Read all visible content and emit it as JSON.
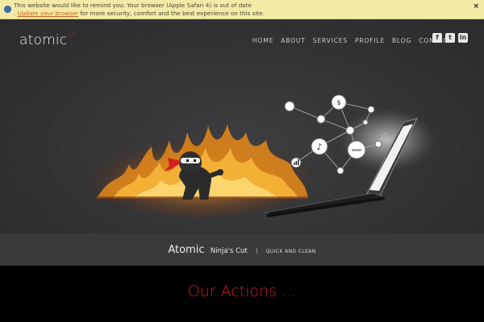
{
  "notice": {
    "line1": "This website would like to remind you: Your browser (Apple Safari 4) is out of date",
    "prefix": ". ",
    "link": "Update your browser",
    "rest": " for more security, comfort and the best experience on this site.",
    "close": "×"
  },
  "header": {
    "logo_text": "atomic",
    "logo_sup": "77",
    "nav": [
      "HOME",
      "ABOUT",
      "SERVICES",
      "PROFILE",
      "BLOG",
      "CONTACT"
    ],
    "social": [
      {
        "name": "facebook-icon",
        "glyph": "f"
      },
      {
        "name": "twitter-icon",
        "glyph": "t"
      },
      {
        "name": "linkedin-icon",
        "glyph": "in"
      }
    ]
  },
  "hero": {
    "www_label": "www"
  },
  "tagline": {
    "strong": "Atomic",
    "sub": "Ninja's Cut",
    "separator": "|",
    "small": "QUICK AND CLEAN"
  },
  "actions": {
    "title": "Our Actions ..."
  },
  "colors": {
    "accent_red": "#d3201f",
    "notice_bg": "#f3eaa8",
    "flame": "#e58a1a"
  }
}
